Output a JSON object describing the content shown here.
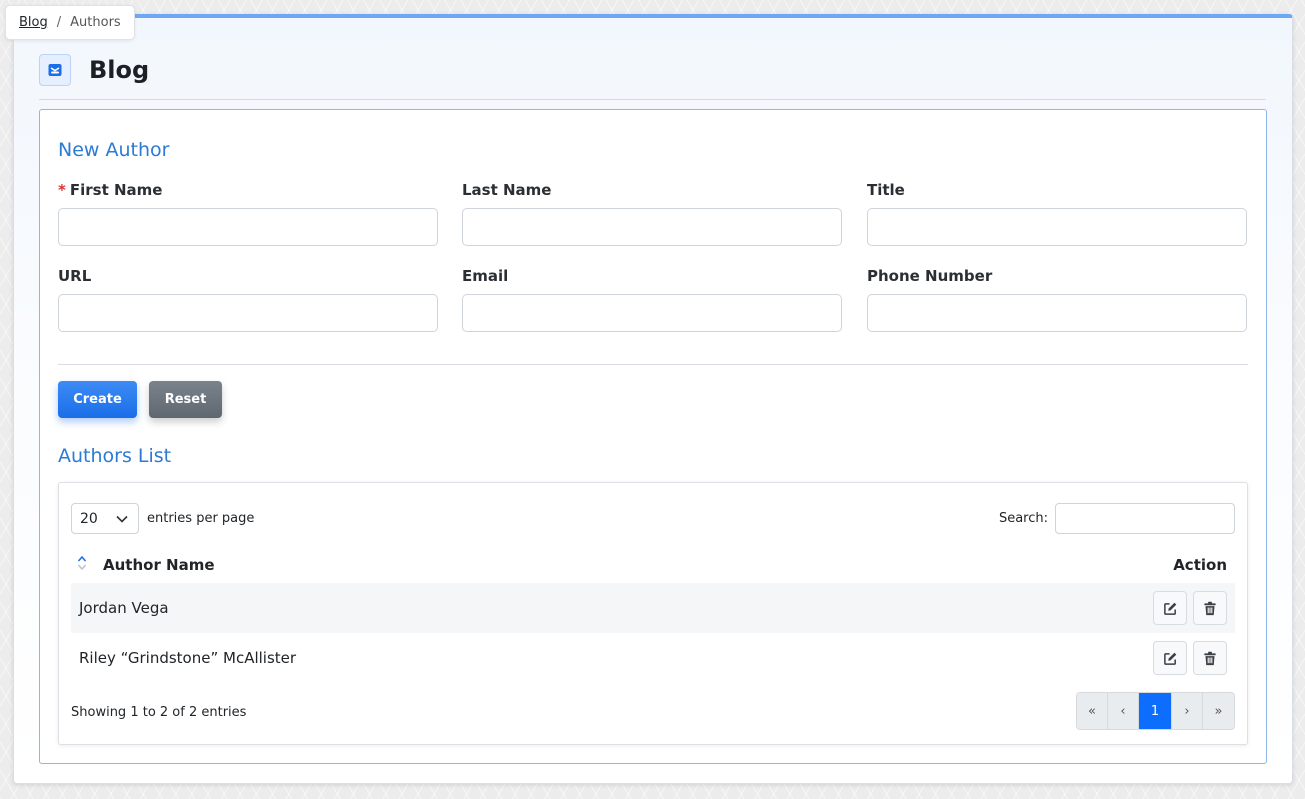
{
  "breadcrumb": {
    "items": [
      {
        "label": "Blog"
      },
      {
        "label": "Authors"
      }
    ],
    "separator": "/"
  },
  "header": {
    "title": "Blog",
    "icon": "inbox-icon"
  },
  "form": {
    "title": "New Author",
    "required_marker": "*",
    "fields": [
      {
        "label": "First Name",
        "value": "",
        "required": true
      },
      {
        "label": "Last Name",
        "value": ""
      },
      {
        "label": "Title",
        "value": ""
      },
      {
        "label": "URL",
        "value": ""
      },
      {
        "label": "Email",
        "value": ""
      },
      {
        "label": "Phone Number",
        "value": ""
      }
    ],
    "create_label": "Create",
    "reset_label": "Reset"
  },
  "list": {
    "title": "Authors List",
    "page_size": "20",
    "page_size_suffix": "entries per page",
    "search_label": "Search:",
    "search_value": "",
    "columns": [
      "Author Name",
      "Action"
    ],
    "rows": [
      {
        "name": "Jordan Vega"
      },
      {
        "name": "Riley “Grindstone” McAllister"
      }
    ],
    "info": "Showing 1 to 2 of 2 entries",
    "pagination": {
      "first": "«",
      "prev": "‹",
      "current": "1",
      "next": "›",
      "last": "»"
    }
  },
  "colors": {
    "accent": "#2b7bd6",
    "primary": "#1a6ee8",
    "secondary": "#6b737c",
    "page_active": "#0d6efd"
  }
}
